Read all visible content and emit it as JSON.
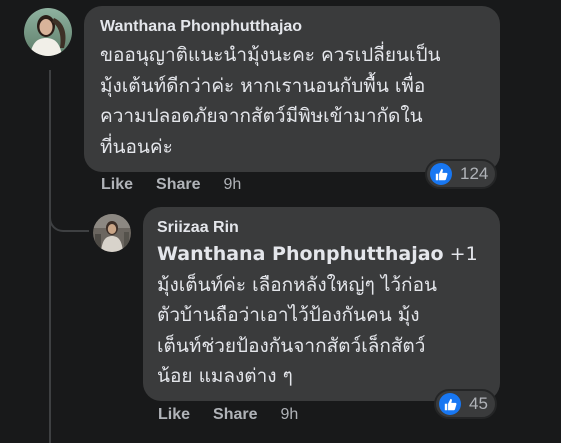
{
  "comments": [
    {
      "author": "Wanthana Phonphutthajao",
      "text": "ขออนุญาติแนะนำมุ้งนะคะ ควรเปลี่ยนเป็น\nมุ้งเต้นท์ดีกว่าค่ะ หากเรานอนกับพื้น เพื่อ\nความปลอดภัยจากสัตว์มีพิษเข้ามากัดใน\nที่นอนค่ะ",
      "reaction_count": "124",
      "reaction_type": "like-icon",
      "actions": {
        "like": "Like",
        "share": "Share",
        "time": "9h"
      }
    },
    {
      "author": "Sriizaa Rin",
      "mention": "Wanthana Phonphutthajao",
      "text_first_line_suffix": " +1",
      "text": "มุ้งเต็นท์ค่ะ เลือกหลังใหญ่ๆ ไว้ก่อน\nตัวบ้านถือว่าเอาไว้ป้องกันคน มุ้ง\nเต็นท์ช่วยป้องกันจากสัตว์เล็กสัตว์\nน้อย แมลงต่าง ๆ",
      "reaction_count": "45",
      "reaction_type": "like-icon",
      "actions": {
        "like": "Like",
        "share": "Share",
        "time": "9h"
      }
    }
  ],
  "colors": {
    "background": "#18191a",
    "bubble": "#3a3b3c",
    "text_primary": "#e4e6eb",
    "text_secondary": "#b0b3b8",
    "like_blue": "#1877f2"
  }
}
